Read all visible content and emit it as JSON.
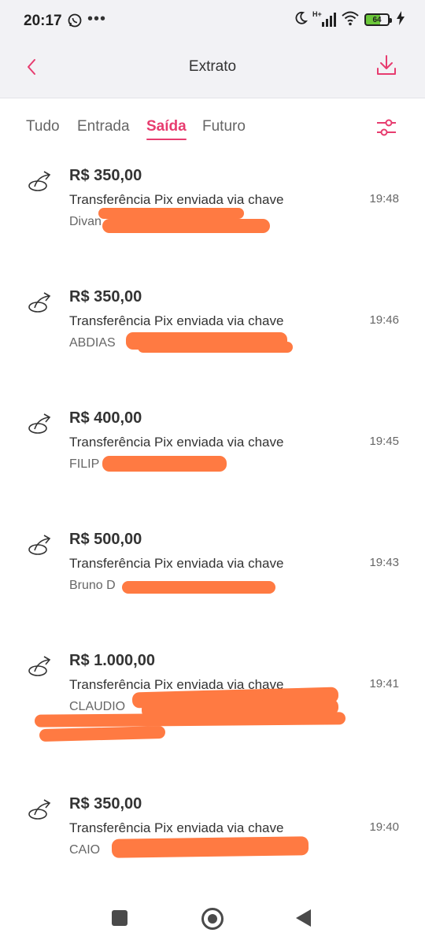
{
  "status_bar": {
    "time": "20:17",
    "more": "•••",
    "network": "H+",
    "battery": "64",
    "whatsapp_icon": "whatsapp-icon",
    "dnd_icon": "moon-icon",
    "wifi_icon": "wifi-icon",
    "charging_icon": "bolt-icon"
  },
  "header": {
    "title": "Extrato",
    "back_icon": "chevron-left-icon",
    "download_icon": "download-icon"
  },
  "tabs": [
    {
      "label": "Tudo",
      "active": false
    },
    {
      "label": "Entrada",
      "active": false
    },
    {
      "label": "Saída",
      "active": true
    },
    {
      "label": "Futuro",
      "active": false
    }
  ],
  "filter_icon": "filter-sliders-icon",
  "accent_color": "#e73c6f",
  "redaction_color": "#ff7a42",
  "transactions": [
    {
      "amount": "R$ 350,00",
      "description": "Transferência Pix enviada via chave",
      "name": "Divan",
      "time": "19:48",
      "icon": "pix-out-icon"
    },
    {
      "amount": "R$ 350,00",
      "description": "Transferência Pix enviada via chave",
      "name": "ABDIAS",
      "time": "19:46",
      "icon": "pix-out-icon"
    },
    {
      "amount": "R$ 400,00",
      "description": "Transferência Pix enviada via chave",
      "name": "FILIP",
      "time": "19:45",
      "icon": "pix-out-icon"
    },
    {
      "amount": "R$ 500,00",
      "description": "Transferência Pix enviada via chave",
      "name": "Bruno D",
      "time": "19:43",
      "icon": "pix-out-icon"
    },
    {
      "amount": "R$ 1.000,00",
      "description": "Transferência Pix enviada via chave",
      "name": "CLAUDIO",
      "time": "19:41",
      "icon": "pix-out-icon"
    },
    {
      "amount": "R$ 350,00",
      "description": "Transferência Pix enviada via chave",
      "name": "CAIO",
      "time": "19:40",
      "icon": "pix-out-icon"
    }
  ],
  "navbar": {
    "recents_icon": "square-icon",
    "home_icon": "circle-icon",
    "back_icon": "triangle-back-icon"
  }
}
